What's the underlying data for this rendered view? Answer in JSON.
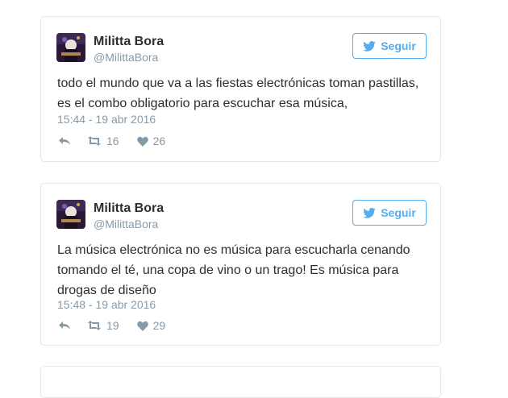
{
  "tweets": [
    {
      "name": "Militta Bora",
      "handle": "@MilittaBora",
      "follow_label": "Seguir",
      "text": "todo el mundo que va a las fiestas electrónicas toman pastillas, es el combo obligatorio para escuchar esa música,",
      "time": "15:44 - 19 abr 2016",
      "retweets": "16",
      "likes": "26",
      "icons": [
        "twitter-bird-icon",
        "reply-icon",
        "retweet-icon",
        "heart-icon"
      ]
    },
    {
      "name": "Militta Bora",
      "handle": "@MilittaBora",
      "follow_label": "Seguir",
      "text": "La música electrónica no es música para escucharla cenando tomando el té, una copa de vino o un trago! Es música para drogas de diseño",
      "time": "15:48 - 19 abr 2016",
      "retweets": "19",
      "likes": "29",
      "icons": [
        "twitter-bird-icon",
        "reply-icon",
        "retweet-icon",
        "heart-icon"
      ]
    }
  ],
  "colors": {
    "accent": "#55acee",
    "text": "#292f33",
    "muted": "#8899a6",
    "border": "#e1e8ed"
  }
}
